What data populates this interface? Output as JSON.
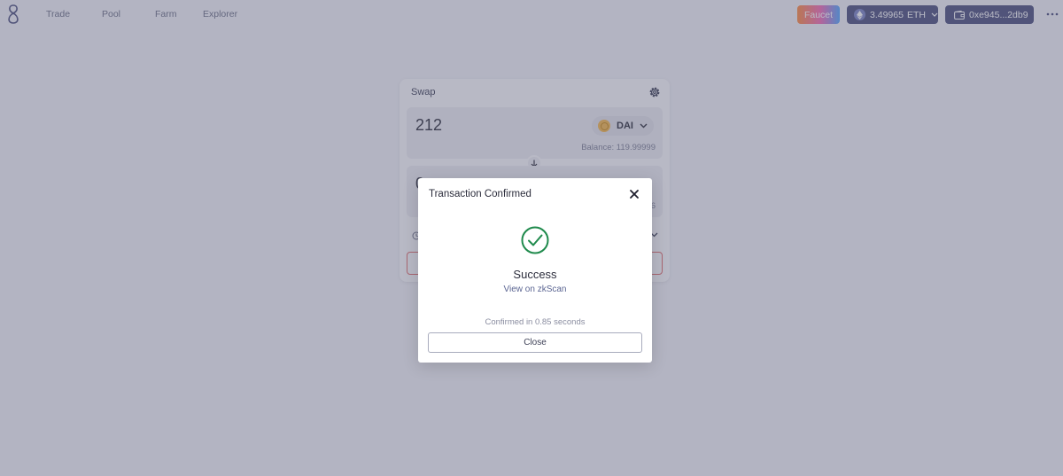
{
  "nav": {
    "items": [
      {
        "label": "Trade"
      },
      {
        "label": "Pool"
      },
      {
        "label": "Farm"
      },
      {
        "label": "Explorer"
      }
    ]
  },
  "header": {
    "faucet_label": "Faucet",
    "eth_balance": "3.49965",
    "eth_symbol": "ETH",
    "wallet_address": "0xe945...2db9"
  },
  "swap": {
    "title": "Swap",
    "from_amount": "212",
    "from_token": "DAI",
    "from_balance": "Balance: 119.99999",
    "to_amount_partial": "0",
    "to_balance_partial": "6"
  },
  "modal": {
    "title": "Transaction Confirmed",
    "status": "Success",
    "link_label": "View on zkScan",
    "confirm_time": "Confirmed in 0.85 seconds",
    "close_label": "Close"
  },
  "colors": {
    "primary_button": "#4a4f7c",
    "success_green": "#1f8a4c",
    "error_border": "#e06b6b"
  }
}
